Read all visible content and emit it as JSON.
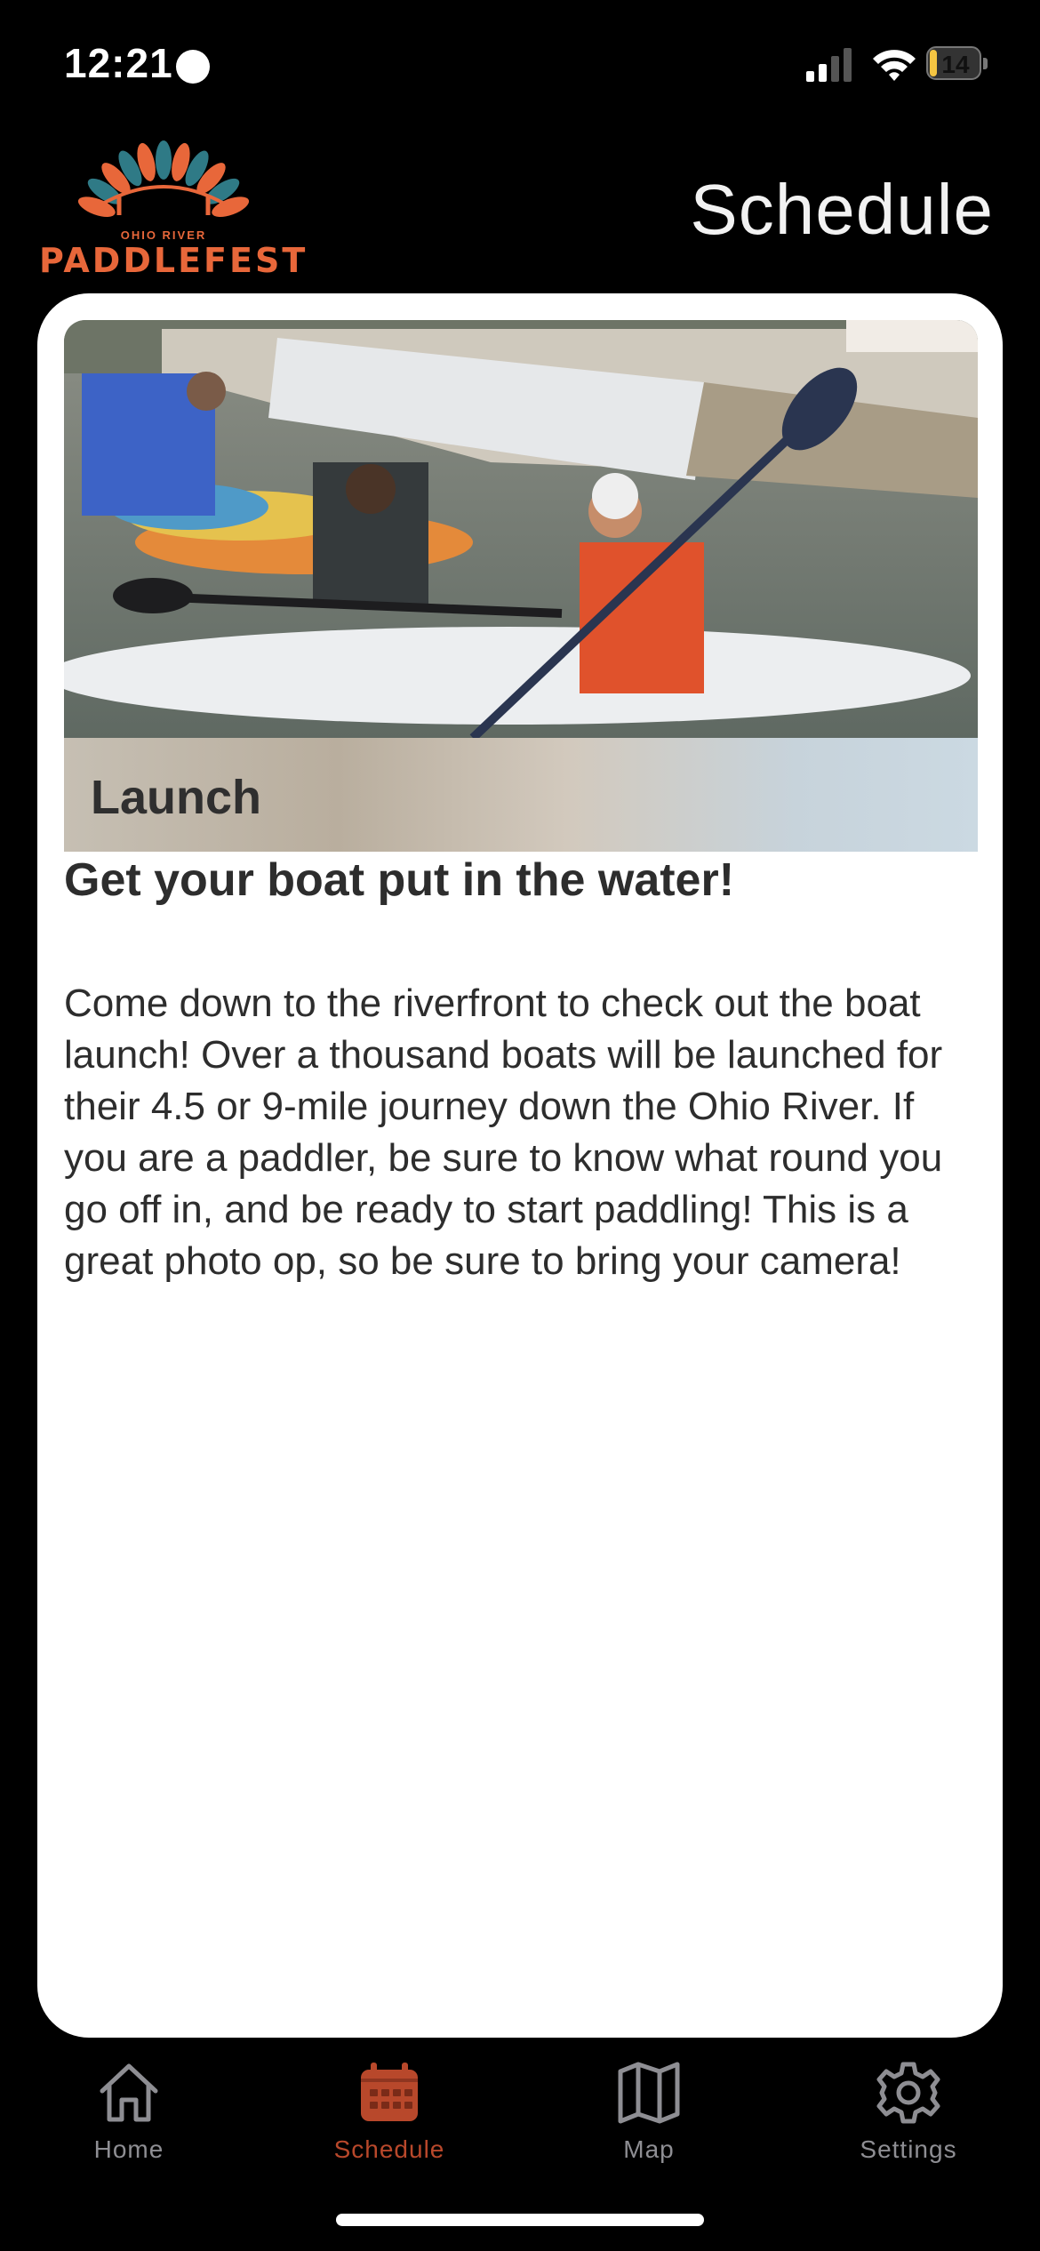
{
  "status_bar": {
    "time": "12:21",
    "battery": "14",
    "battery_level": 0.14
  },
  "header": {
    "logo_text": "PADDLEFEST",
    "logo_subtext": "OHIO RIVER",
    "title": "Schedule"
  },
  "event": {
    "label": "Launch",
    "title": "Get your boat put in the water!",
    "description": "Come down to the riverfront to check out the boat launch! Over a thousand boats will be launched for their 4.5 or 9-mile journey down the Ohio River. If you are a paddler, be sure to know what round you go off in, and be ready to start paddling! This is a great photo op, so be sure to bring your camera!"
  },
  "tabs": [
    {
      "label": "Home",
      "icon": "home-icon",
      "active": false
    },
    {
      "label": "Schedule",
      "icon": "calendar-icon",
      "active": true
    },
    {
      "label": "Map",
      "icon": "map-icon",
      "active": false
    },
    {
      "label": "Settings",
      "icon": "gear-icon",
      "active": false
    }
  ],
  "colors": {
    "accent": "#b8482b",
    "inactive_tab": "#8e8e93",
    "background": "#000000",
    "card": "#ffffff"
  }
}
